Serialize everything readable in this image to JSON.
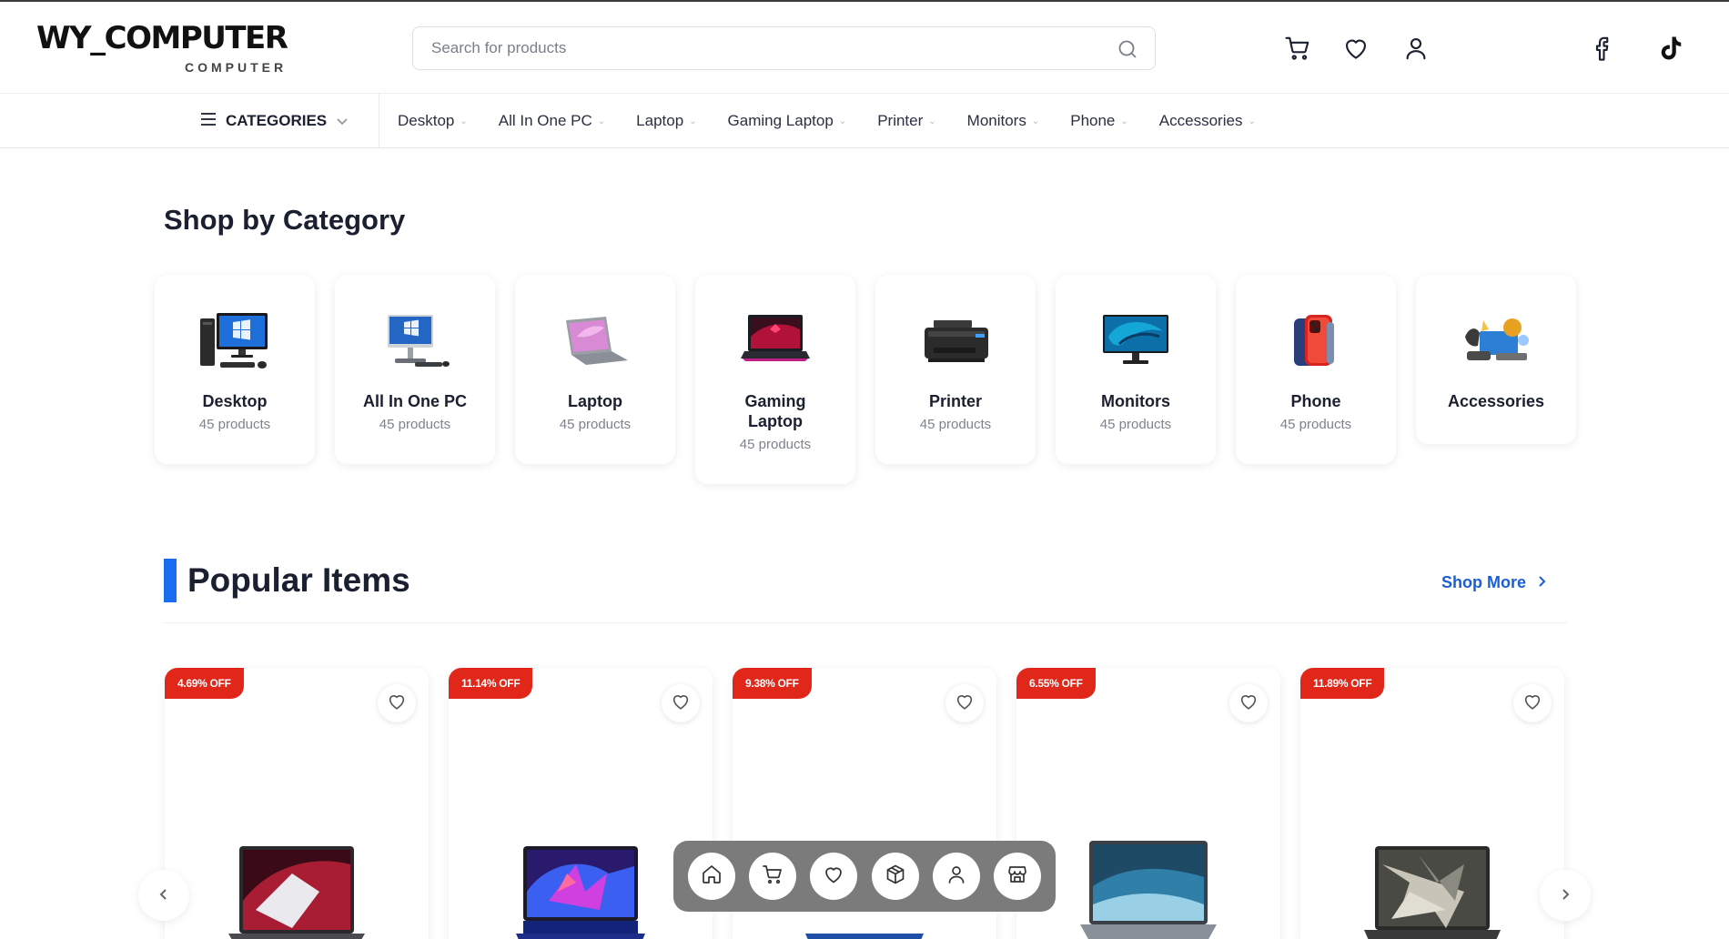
{
  "header": {
    "logo_main": "WY_COMPUTER",
    "logo_sub": "COMPUTER",
    "search_placeholder": "Search for products",
    "icons": [
      "cart-icon",
      "heart-icon",
      "user-icon",
      "facebook-icon",
      "tiktok-icon"
    ]
  },
  "nav": {
    "categories_label": "CATEGORIES",
    "items": [
      {
        "label": "Desktop"
      },
      {
        "label": "All In One PC"
      },
      {
        "label": "Laptop"
      },
      {
        "label": "Gaming Laptop"
      },
      {
        "label": "Printer"
      },
      {
        "label": "Monitors"
      },
      {
        "label": "Phone"
      },
      {
        "label": "Accessories"
      }
    ]
  },
  "categories_section": {
    "title": "Shop by Category",
    "items": [
      {
        "name": "Desktop",
        "count": "45 products"
      },
      {
        "name": "All In One PC",
        "count": "45 products"
      },
      {
        "name": "Laptop",
        "count": "45 products"
      },
      {
        "name": "Gaming Laptop",
        "count": "45 products"
      },
      {
        "name": "Printer",
        "count": "45 products"
      },
      {
        "name": "Monitors",
        "count": "45 products"
      },
      {
        "name": "Phone",
        "count": "45 products"
      },
      {
        "name": "Accessories",
        "count": ""
      }
    ]
  },
  "popular": {
    "title": "Popular Items",
    "shop_more": "Shop More",
    "products": [
      {
        "badge": "4.69% OFF"
      },
      {
        "badge": "11.14% OFF"
      },
      {
        "badge": "9.38% OFF"
      },
      {
        "badge": "6.55% OFF"
      },
      {
        "badge": "11.89% OFF"
      }
    ]
  },
  "dock": {
    "icons": [
      "home-icon",
      "cart-icon",
      "heart-icon",
      "box-icon",
      "user-icon",
      "store-icon"
    ]
  },
  "colors": {
    "accent": "#1a6df0",
    "badge": "#e0271a",
    "link": "#1a5fd6"
  }
}
